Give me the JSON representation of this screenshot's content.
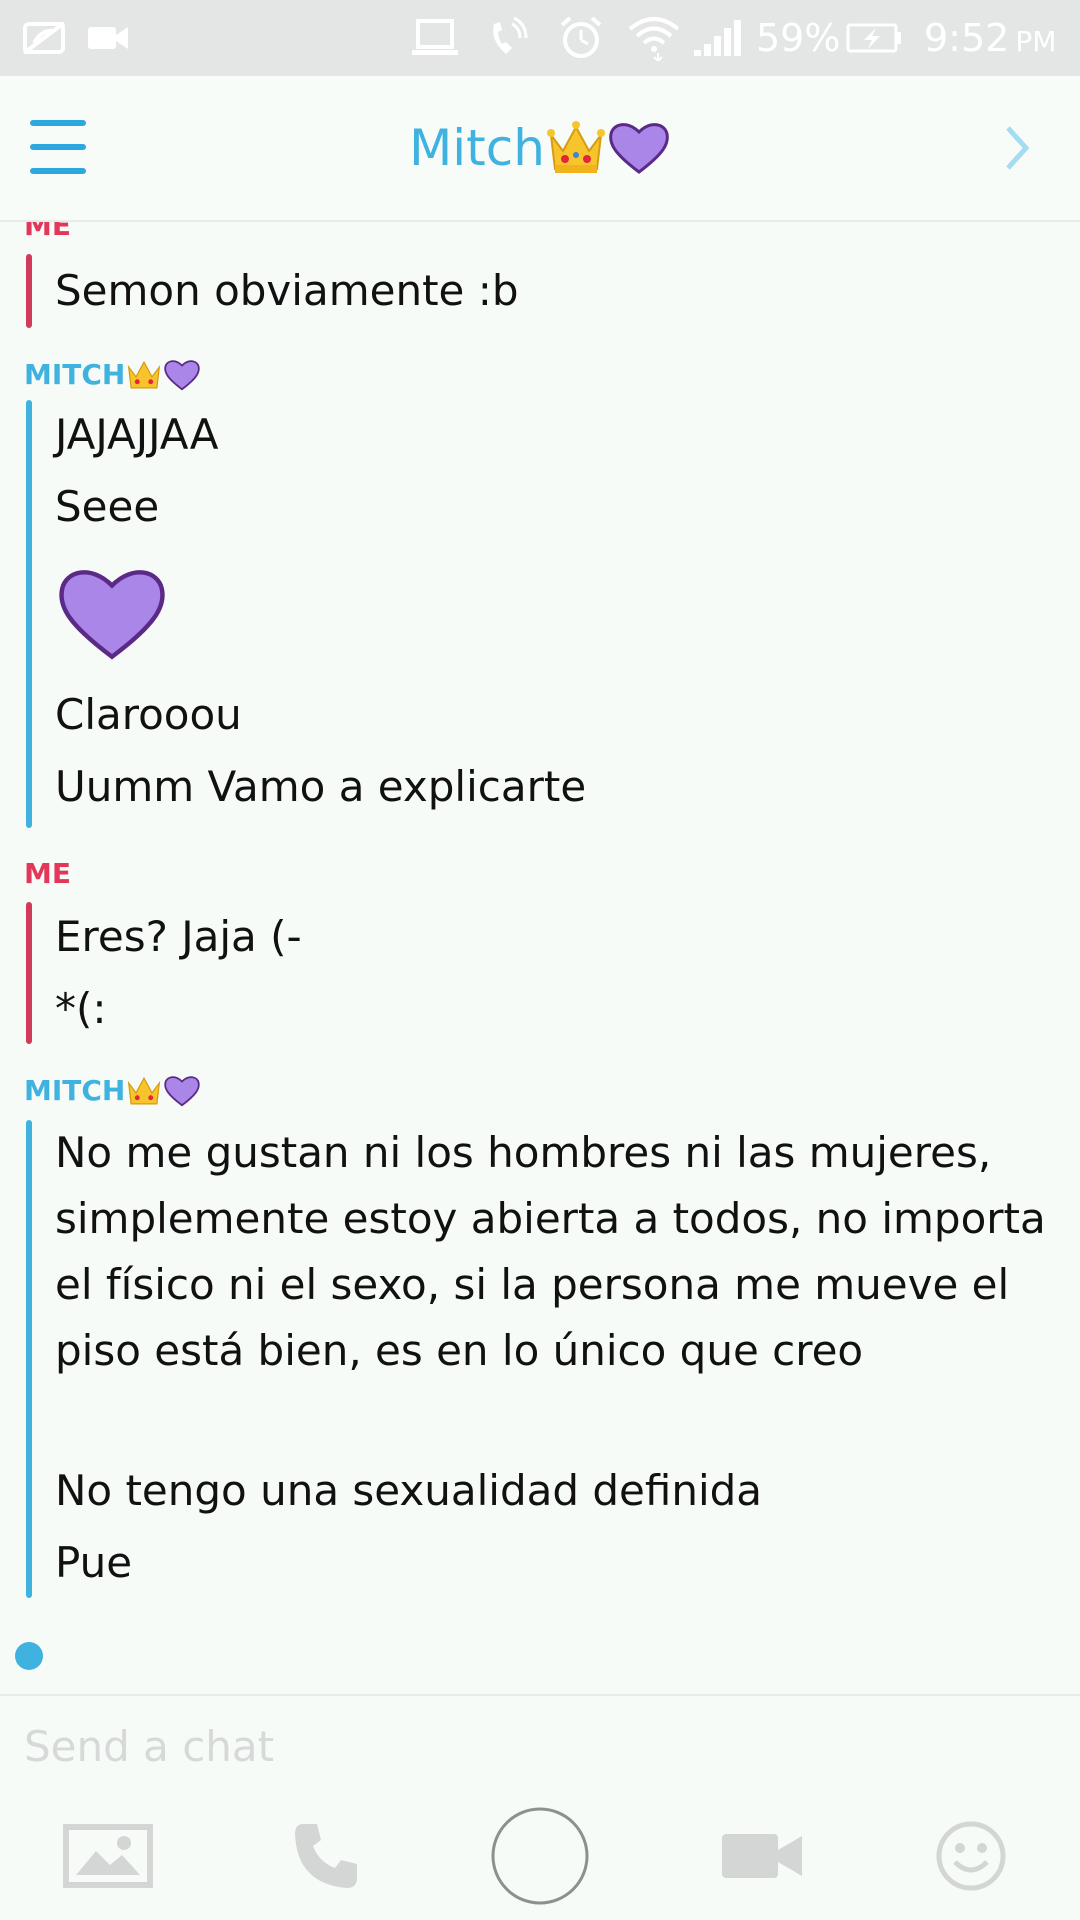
{
  "status_bar": {
    "battery_percent": "59%",
    "time": "9:52",
    "time_suffix": "PM",
    "icons": [
      "no-notification-icon",
      "video-camera-icon",
      "laptop-icon",
      "phone-vibrate-icon",
      "alarm-icon",
      "wifi-icon",
      "signal-icon",
      "battery-charging-icon"
    ]
  },
  "header": {
    "title": "Mitch",
    "title_emojis": [
      "crown-emoji",
      "purple-heart-emoji"
    ],
    "menu_icon": "hamburger-icon",
    "nav_icon": "chevron-right-icon"
  },
  "conversation": {
    "groups": [
      {
        "sender": "ME",
        "messages": [
          "Semon obviamente :b"
        ]
      },
      {
        "sender": "MITCH",
        "sender_emojis": [
          "crown-emoji",
          "purple-heart-emoji"
        ],
        "messages": [
          "JAJAJJAA",
          "Seee",
          "[purple-heart]",
          "Clarooou",
          "Uumm Vamo a explicarte"
        ]
      },
      {
        "sender": "ME",
        "messages": [
          "Eres? Jaja (-",
          "*(:"
        ]
      },
      {
        "sender": "MITCH",
        "sender_emojis": [
          "crown-emoji",
          "purple-heart-emoji"
        ],
        "messages": [
          "No me gustan ni los hombres ni las mujeres, simplemente estoy abierta a todos, no importa el físico ni el sexo, si la persona me mueve el piso está bien, es en lo único que creo",
          "No tengo una sexualidad definida",
          "Pue"
        ]
      }
    ]
  },
  "input": {
    "placeholder": "Send a chat"
  },
  "toolbar": {
    "buttons": [
      "image-icon",
      "phone-icon",
      "capture-button",
      "video-call-icon",
      "smiley-icon"
    ]
  },
  "colors": {
    "accent_blue": "#3fb2e0",
    "me_red": "#e2375a",
    "background": "#f6fbf7",
    "status_bar": "#e4e6e5"
  }
}
